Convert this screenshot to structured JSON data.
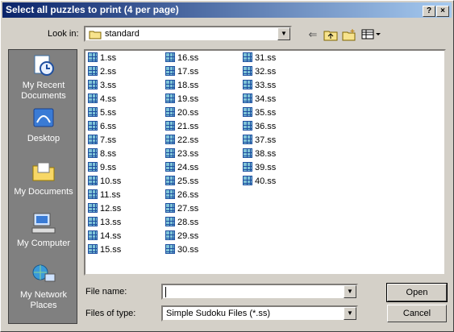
{
  "window": {
    "title": "Select all puzzles to print (4 per page)",
    "help_glyph": "?",
    "close_glyph": "×"
  },
  "toolbar": {
    "look_in_label": "Look in:",
    "look_in_value": "standard",
    "icons": [
      "back-icon",
      "up-folder-icon",
      "new-folder-icon",
      "view-menu-icon"
    ]
  },
  "places": [
    {
      "name": "my-recent-documents",
      "label": "My Recent Documents"
    },
    {
      "name": "desktop",
      "label": "Desktop"
    },
    {
      "name": "my-documents",
      "label": "My Documents"
    },
    {
      "name": "my-computer",
      "label": "My Computer"
    },
    {
      "name": "my-network-places",
      "label": "My Network Places"
    }
  ],
  "files": [
    "1.ss",
    "2.ss",
    "3.ss",
    "4.ss",
    "5.ss",
    "6.ss",
    "7.ss",
    "8.ss",
    "9.ss",
    "10.ss",
    "11.ss",
    "12.ss",
    "13.ss",
    "14.ss",
    "15.ss",
    "16.ss",
    "17.ss",
    "18.ss",
    "19.ss",
    "20.ss",
    "21.ss",
    "22.ss",
    "23.ss",
    "24.ss",
    "25.ss",
    "26.ss",
    "27.ss",
    "28.ss",
    "29.ss",
    "30.ss",
    "31.ss",
    "32.ss",
    "33.ss",
    "34.ss",
    "35.ss",
    "36.ss",
    "37.ss",
    "38.ss",
    "39.ss",
    "40.ss"
  ],
  "form": {
    "file_name_label": "File name:",
    "file_name_value": "",
    "file_type_label": "Files of type:",
    "file_type_value": "Simple Sudoku Files (*.ss)"
  },
  "buttons": {
    "open": "Open",
    "cancel": "Cancel"
  }
}
